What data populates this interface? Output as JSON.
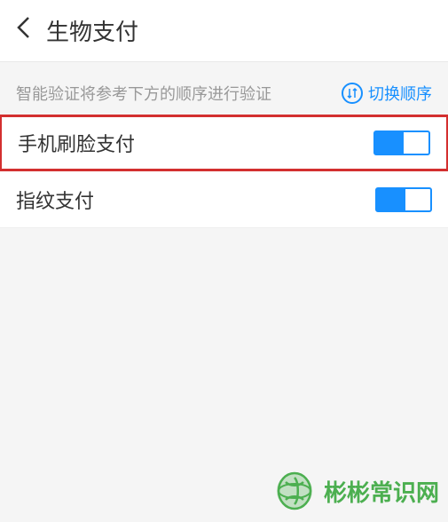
{
  "header": {
    "title": "生物支付"
  },
  "info": {
    "description": "智能验证将参考下方的顺序进行验证",
    "switch_label": "切换顺序"
  },
  "settings": [
    {
      "label": "手机刷脸支付",
      "enabled": true,
      "highlighted": true
    },
    {
      "label": "指纹支付",
      "enabled": true,
      "highlighted": false
    }
  ],
  "watermark": {
    "text": "彬彬常识网"
  }
}
